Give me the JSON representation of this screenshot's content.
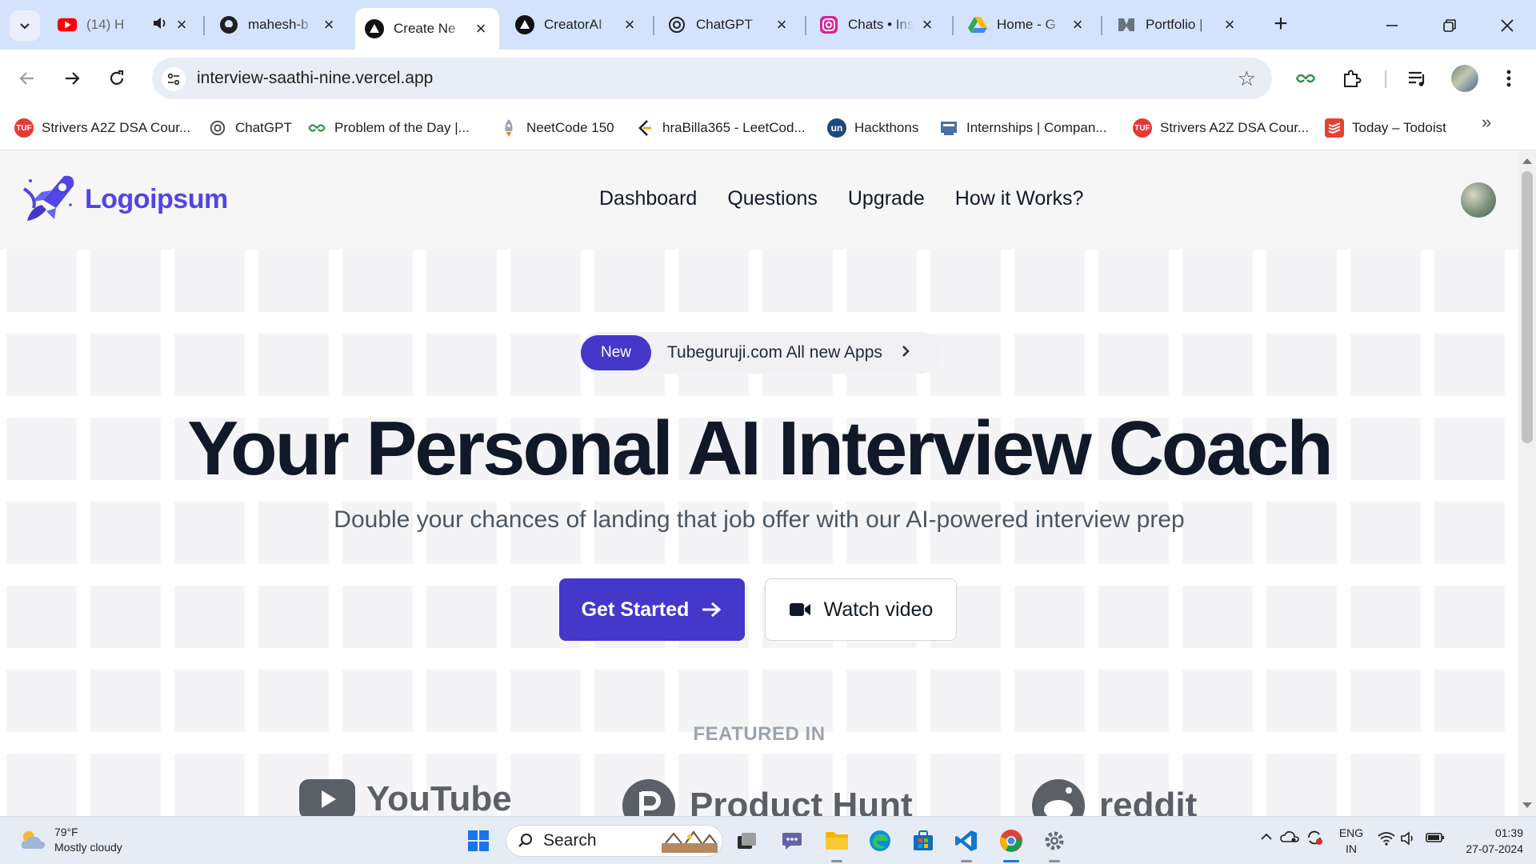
{
  "browser": {
    "tabs": [
      {
        "title": "(14) H",
        "favicon": "youtube-icon",
        "extra_icon": "speaker-icon",
        "active": false
      },
      {
        "title": "mahesh-b",
        "favicon": "github-icon",
        "active": false
      },
      {
        "title": "Create Ne",
        "favicon": "vercel-icon",
        "active": true
      },
      {
        "title": "CreatorAI",
        "favicon": "vercel-icon",
        "active": false
      },
      {
        "title": "ChatGPT",
        "favicon": "chatgpt-icon",
        "active": false
      },
      {
        "title": "Chats • Ins",
        "favicon": "instagram-icon",
        "active": false
      },
      {
        "title": "Home - G",
        "favicon": "google-drive-icon",
        "active": false
      },
      {
        "title": "Portfolio |",
        "favicon": "portfolio-icon",
        "active": false
      }
    ],
    "url": "interview-saathi-nine.vercel.app",
    "bookmarks": [
      {
        "label": "Strivers A2Z DSA Cour...",
        "icon": "tuf-icon",
        "color": "#e53935"
      },
      {
        "label": "ChatGPT",
        "icon": "chatgpt-icon",
        "color": "#444444"
      },
      {
        "label": "Problem of the Day |...",
        "icon": "gfg-icon",
        "color": "#2f8d46"
      },
      {
        "label": "NeetCode 150",
        "icon": "rocket-icon",
        "color": "#6b7280"
      },
      {
        "label": "hraBilla365 - LeetCod...",
        "icon": "leetcode-icon",
        "color": "#f89f1b"
      },
      {
        "label": "Hackthons",
        "icon": "unstop-icon",
        "color": "#1c4980"
      },
      {
        "label": "Internships | Compan...",
        "icon": "internshala-icon",
        "color": "#4a6fa5"
      },
      {
        "label": "Strivers A2Z DSA Cour...",
        "icon": "tuf-icon",
        "color": "#e53935"
      },
      {
        "label": "Today – Todoist",
        "icon": "todoist-icon",
        "color": "#e44332"
      }
    ]
  },
  "site": {
    "logo_text": "Logoipsum",
    "nav": [
      "Dashboard",
      "Questions",
      "Upgrade",
      "How it Works?"
    ],
    "announcement": {
      "badge": "New",
      "text": "Tubeguruji.com All new Apps"
    },
    "headline": "Your Personal AI Interview Coach",
    "subheadline": "Double your chances of landing that job offer with our AI-powered interview prep",
    "cta_primary": "Get Started",
    "cta_secondary": "Watch video",
    "featured_label": "FEATURED IN",
    "brands": [
      "YouTube",
      "Product Hunt",
      "reddit"
    ]
  },
  "taskbar": {
    "weather_temp": "79°F",
    "weather_desc": "Mostly cloudy",
    "search_label": "Search",
    "lang_line1": "ENG",
    "lang_line2": "IN",
    "time": "01:39",
    "date": "27-07-2024"
  },
  "colors": {
    "accent": "#4338ca",
    "logo": "#4f46e5",
    "tabstrip": "#d3e3fd"
  }
}
